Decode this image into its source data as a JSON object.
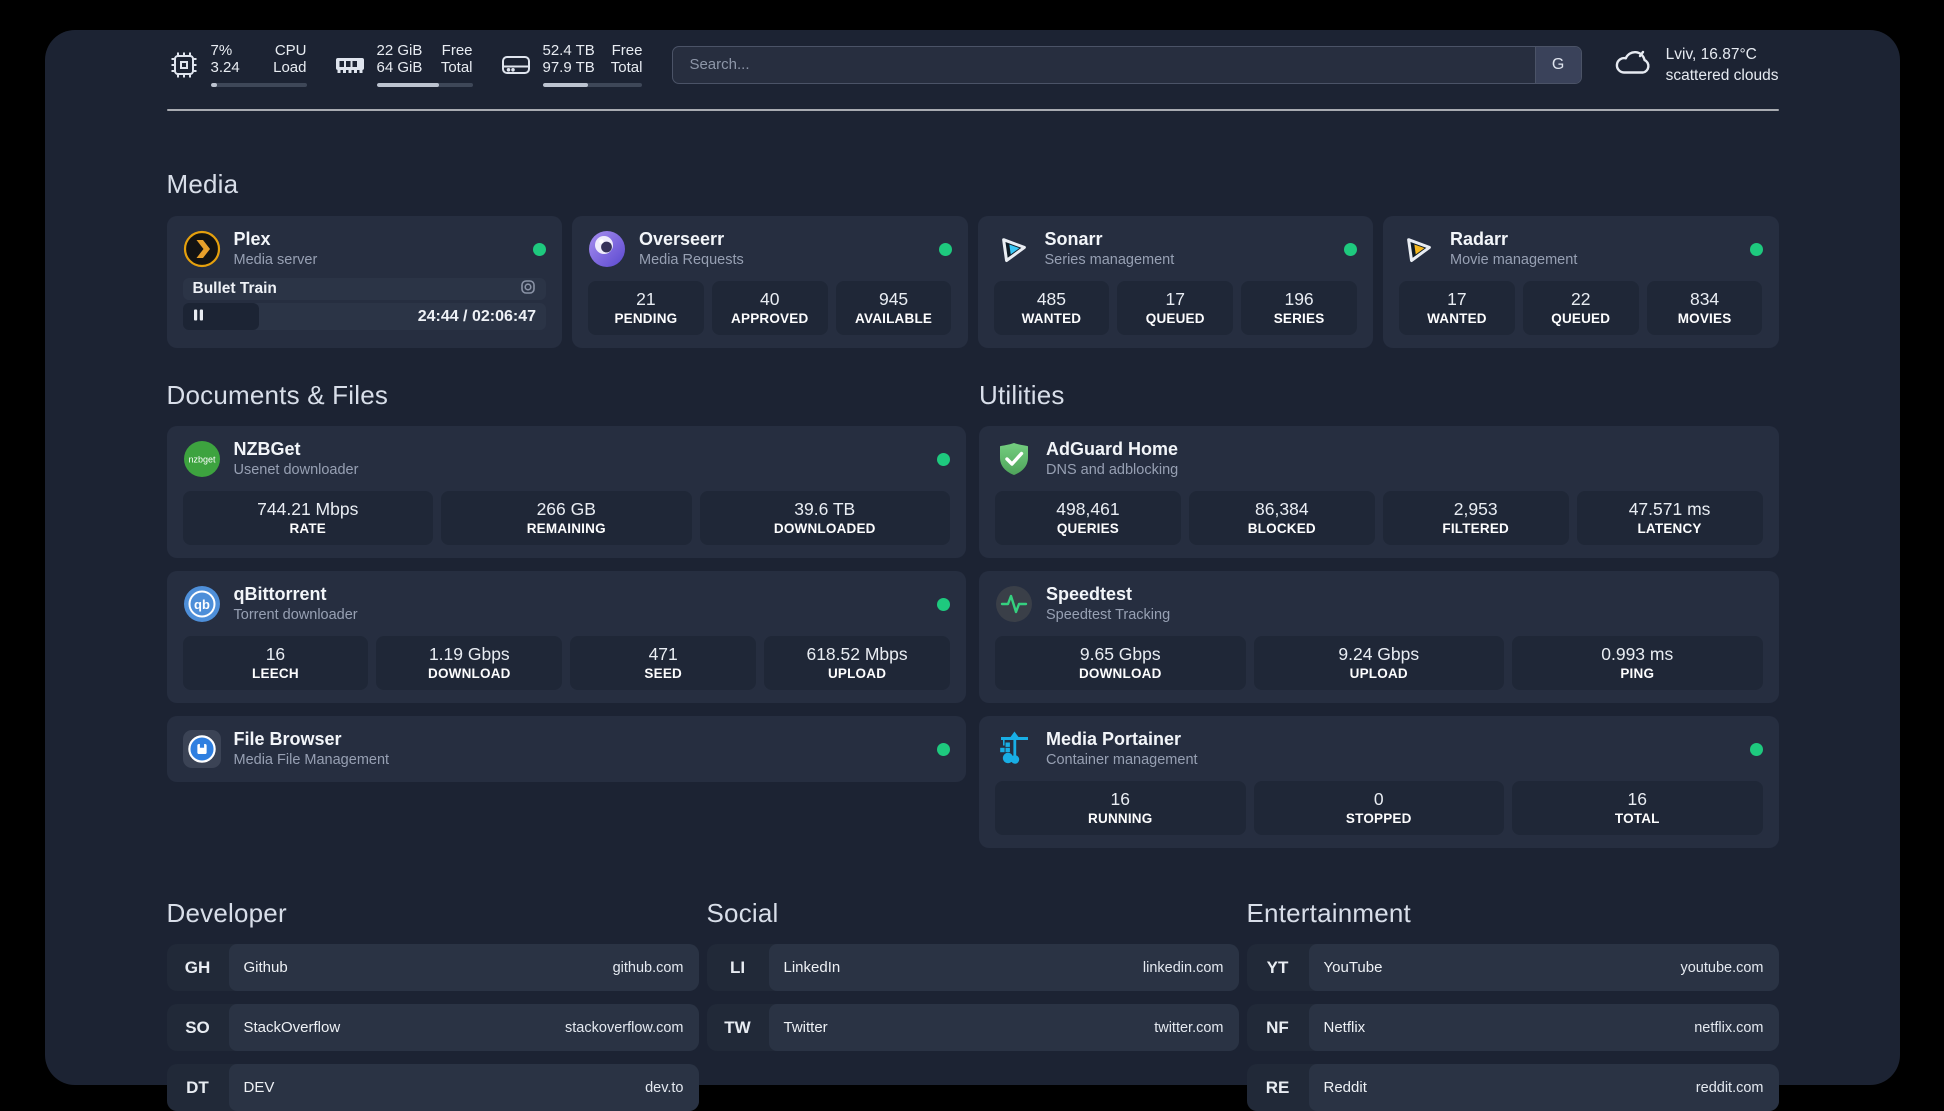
{
  "header": {
    "stats": [
      {
        "icon": "cpu-icon",
        "values": [
          "7%",
          "3.24"
        ],
        "labels": [
          "CPU",
          "Load"
        ],
        "progress": 7
      },
      {
        "icon": "memory-icon",
        "values": [
          "22 GiB",
          "64 GiB"
        ],
        "labels": [
          "Free",
          "Total"
        ],
        "progress": 65
      },
      {
        "icon": "storage-icon",
        "values": [
          "52.4 TB",
          "97.9 TB"
        ],
        "labels": [
          "Free",
          "Total"
        ],
        "progress": 46
      }
    ],
    "search": {
      "placeholder": "Search...",
      "engine_label": "G"
    },
    "weather": {
      "icon": "cloud-icon",
      "location": "Lviv, 16.87°C",
      "condition": "scattered clouds"
    }
  },
  "sections": {
    "media": {
      "title": "Media"
    },
    "documents": {
      "title": "Documents & Files"
    },
    "utilities": {
      "title": "Utilities"
    },
    "developer": {
      "title": "Developer"
    },
    "social": {
      "title": "Social"
    },
    "entertainment": {
      "title": "Entertainment"
    }
  },
  "apps": {
    "plex": {
      "name": "Plex",
      "subtitle": "Media server",
      "icon": "plex-icon",
      "online": true,
      "now_playing": {
        "title": "Bullet Train",
        "time": "24:44 / 02:06:47",
        "progress_percent": 21
      }
    },
    "overseerr": {
      "name": "Overseerr",
      "subtitle": "Media Requests",
      "icon": "overseerr-icon",
      "online": true,
      "stats": [
        {
          "value": "21",
          "label": "PENDING"
        },
        {
          "value": "40",
          "label": "APPROVED"
        },
        {
          "value": "945",
          "label": "AVAILABLE"
        }
      ]
    },
    "sonarr": {
      "name": "Sonarr",
      "subtitle": "Series management",
      "icon": "sonarr-icon",
      "online": true,
      "stats": [
        {
          "value": "485",
          "label": "WANTED"
        },
        {
          "value": "17",
          "label": "QUEUED"
        },
        {
          "value": "196",
          "label": "SERIES"
        }
      ]
    },
    "radarr": {
      "name": "Radarr",
      "subtitle": "Movie management",
      "icon": "radarr-icon",
      "online": true,
      "stats": [
        {
          "value": "17",
          "label": "WANTED"
        },
        {
          "value": "22",
          "label": "QUEUED"
        },
        {
          "value": "834",
          "label": "MOVIES"
        }
      ]
    },
    "nzbget": {
      "name": "NZBGet",
      "subtitle": "Usenet downloader",
      "icon": "nzbget-icon",
      "online": true,
      "stats": [
        {
          "value": "744.21 Mbps",
          "label": "RATE"
        },
        {
          "value": "266 GB",
          "label": "REMAINING"
        },
        {
          "value": "39.6 TB",
          "label": "DOWNLOADED"
        }
      ]
    },
    "qbittorrent": {
      "name": "qBittorrent",
      "subtitle": "Torrent downloader",
      "icon": "qbittorrent-icon",
      "online": true,
      "stats": [
        {
          "value": "16",
          "label": "LEECH"
        },
        {
          "value": "1.19 Gbps",
          "label": "DOWNLOAD"
        },
        {
          "value": "471",
          "label": "SEED"
        },
        {
          "value": "618.52 Mbps",
          "label": "UPLOAD"
        }
      ]
    },
    "filebrowser": {
      "name": "File Browser",
      "subtitle": "Media File Management",
      "icon": "filebrowser-icon",
      "online": true
    },
    "adguard": {
      "name": "AdGuard Home",
      "subtitle": "DNS and adblocking",
      "icon": "adguard-icon",
      "stats": [
        {
          "value": "498,461",
          "label": "QUERIES"
        },
        {
          "value": "86,384",
          "label": "BLOCKED"
        },
        {
          "value": "2,953",
          "label": "FILTERED"
        },
        {
          "value": "47.571 ms",
          "label": "LATENCY"
        }
      ]
    },
    "speedtest": {
      "name": "Speedtest",
      "subtitle": "Speedtest Tracking",
      "icon": "speedtest-icon",
      "stats": [
        {
          "value": "9.65 Gbps",
          "label": "DOWNLOAD"
        },
        {
          "value": "9.24 Gbps",
          "label": "UPLOAD"
        },
        {
          "value": "0.993 ms",
          "label": "PING"
        }
      ]
    },
    "portainer": {
      "name": "Media Portainer",
      "subtitle": "Container management",
      "icon": "portainer-icon",
      "online": true,
      "stats": [
        {
          "value": "16",
          "label": "RUNNING"
        },
        {
          "value": "0",
          "label": "STOPPED"
        },
        {
          "value": "16",
          "label": "TOTAL"
        }
      ]
    }
  },
  "bookmarks": {
    "developer": [
      {
        "abbr": "GH",
        "name": "Github",
        "url": "github.com"
      },
      {
        "abbr": "SO",
        "name": "StackOverflow",
        "url": "stackoverflow.com"
      },
      {
        "abbr": "DT",
        "name": "DEV",
        "url": "dev.to"
      }
    ],
    "social": [
      {
        "abbr": "LI",
        "name": "LinkedIn",
        "url": "linkedin.com"
      },
      {
        "abbr": "TW",
        "name": "Twitter",
        "url": "twitter.com"
      }
    ],
    "entertainment": [
      {
        "abbr": "YT",
        "name": "YouTube",
        "url": "youtube.com"
      },
      {
        "abbr": "NF",
        "name": "Netflix",
        "url": "netflix.com"
      },
      {
        "abbr": "RE",
        "name": "Reddit",
        "url": "reddit.com"
      }
    ]
  },
  "colors": {
    "status_online": "#1ec97e",
    "plex_orange": "#e8a02a",
    "sonarr_blue": "#38c6f4",
    "radarr_amber": "#f6b81e",
    "adguard_green": "#67c174",
    "nzbget_green": "#3da33f",
    "qbittorrent_blue": "#4e8fd9",
    "filebrowser_blue": "#2f7fe0",
    "portainer_blue": "#18aee5"
  }
}
